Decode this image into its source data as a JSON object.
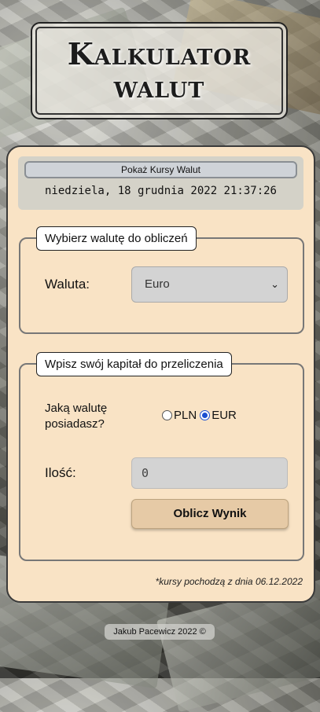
{
  "header": {
    "title_line1": "Kalkulator",
    "title_line2": "walut"
  },
  "rates": {
    "show_button_label": "Pokaż Kursy Walut",
    "datetime": "niedziela, 18 grudnia 2022 21:37:26"
  },
  "currency_section": {
    "legend": "Wybierz walutę do obliczeń",
    "currency_label": "Waluta:",
    "selected_currency": "Euro"
  },
  "capital_section": {
    "legend": "Wpisz swój kapitał do przeliczenia",
    "question": "Jaką walutę posiadasz?",
    "options": [
      {
        "label": "PLN",
        "checked": false
      },
      {
        "label": "EUR",
        "checked": true
      }
    ],
    "amount_label": "Ilość:",
    "amount_placeholder": "0",
    "submit_label": "Oblicz Wynik"
  },
  "footnote": "*kursy pochodzą z dnia 06.12.2022",
  "footer": "Jakub Pacewicz 2022 ©"
}
